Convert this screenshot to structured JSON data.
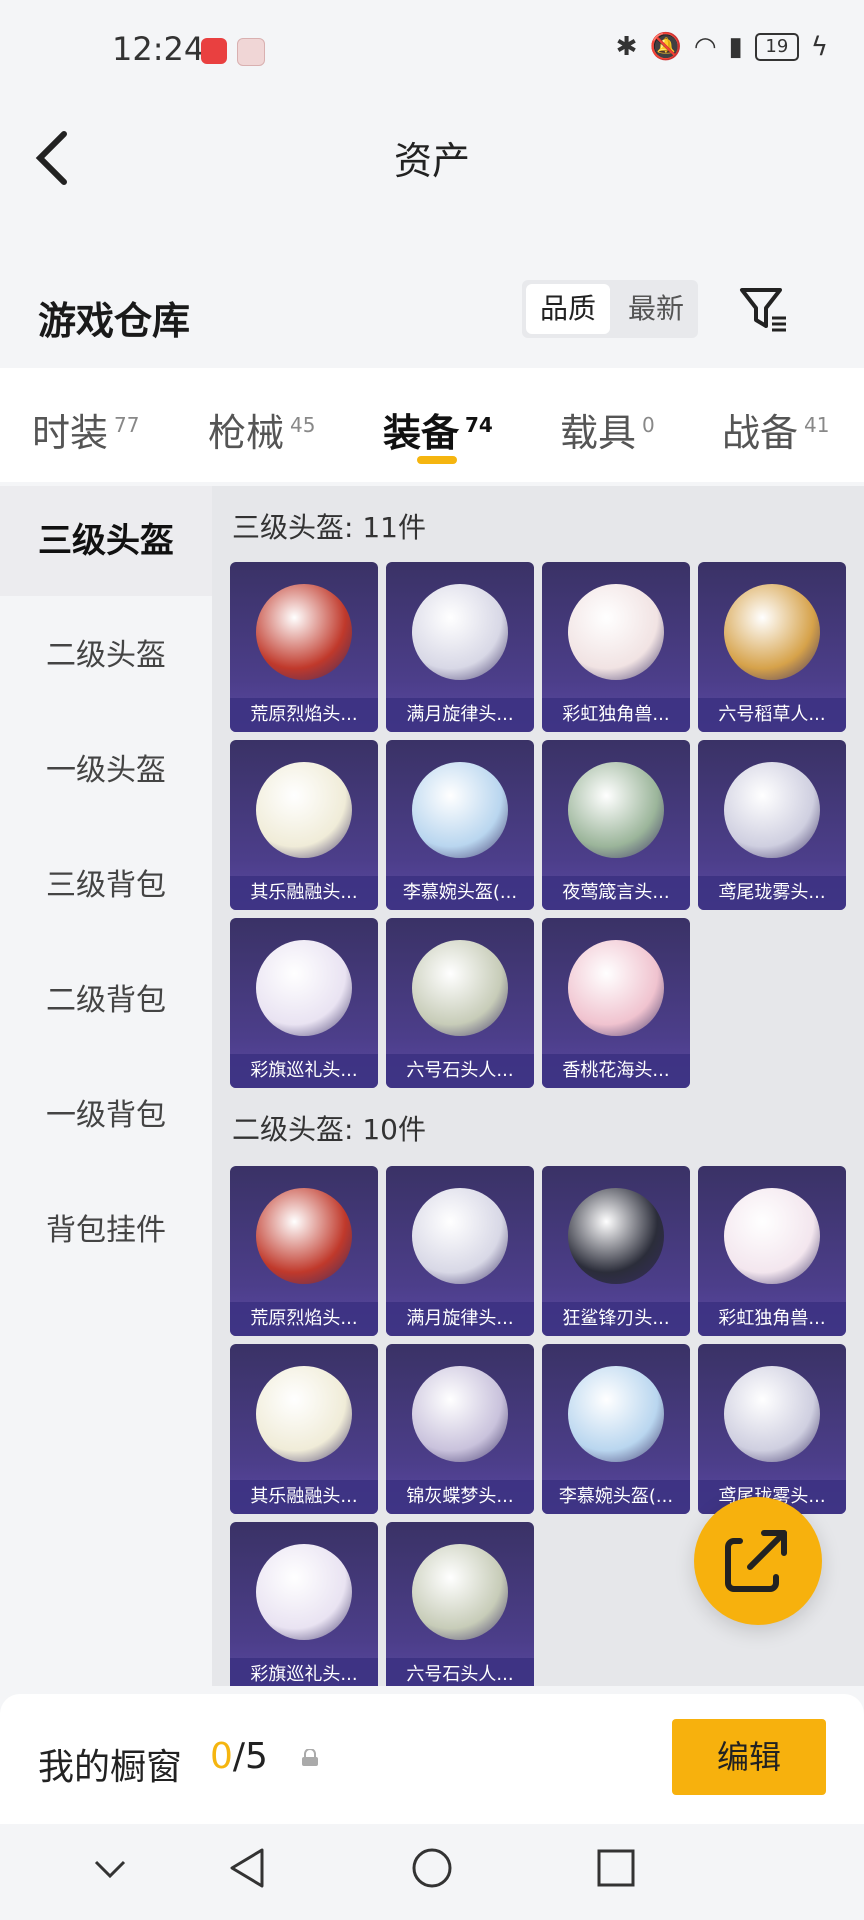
{
  "status_bar": {
    "time": "12:24",
    "battery": "19"
  },
  "header": {
    "title": "资产"
  },
  "section": {
    "title": "游戏仓库",
    "sort_options": [
      "品质",
      "最新"
    ]
  },
  "tabs": [
    {
      "label": "时装",
      "count": "77"
    },
    {
      "label": "枪械",
      "count": "45"
    },
    {
      "label": "装备",
      "count": "74"
    },
    {
      "label": "载具",
      "count": "0"
    },
    {
      "label": "战备",
      "count": "41"
    }
  ],
  "sidebar": [
    "三级头盔",
    "二级头盔",
    "一级头盔",
    "三级背包",
    "二级背包",
    "一级背包",
    "背包挂件"
  ],
  "groups": [
    {
      "title": "三级头盔: 11件",
      "items": [
        "荒原烈焰头...",
        "满月旋律头...",
        "彩虹独角兽...",
        "六号稻草人...",
        "其乐融融头...",
        "李慕婉头盔(...",
        "夜莺箴言头...",
        "鸢尾珑雾头...",
        "彩旗巡礼头...",
        "六号石头人...",
        "香桃花海头..."
      ]
    },
    {
      "title": "二级头盔: 10件",
      "items": [
        "荒原烈焰头...",
        "满月旋律头...",
        "狂鲨锋刃头...",
        "彩虹独角兽...",
        "其乐融融头...",
        "锦灰蝶梦头...",
        "李慕婉头盔(...",
        "鸢尾珑雾头...",
        "彩旗巡礼头...",
        "六号石头人..."
      ]
    }
  ],
  "showcase": {
    "label": "我的橱窗",
    "current": "0",
    "total": "/5",
    "edit_label": "编辑"
  },
  "colors": {
    "accent": "#f5b50f",
    "card_bg": "#4c3e8a"
  }
}
